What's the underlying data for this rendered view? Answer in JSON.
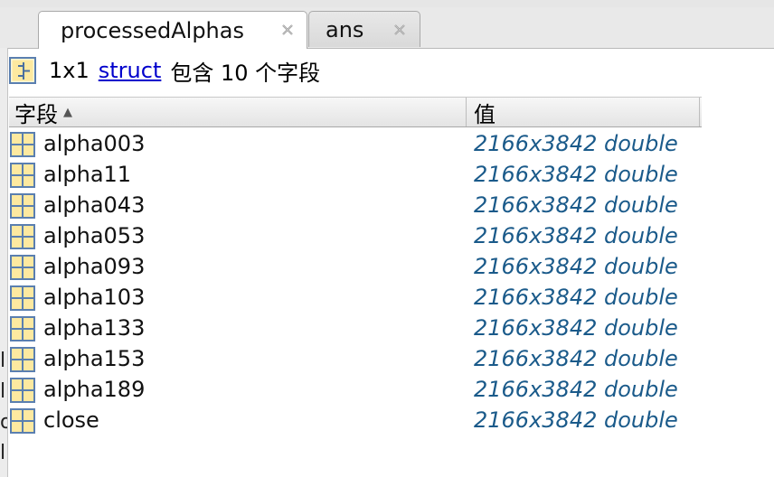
{
  "tabs": [
    {
      "label": "processedAlphas",
      "active": true
    },
    {
      "label": "ans",
      "active": false
    }
  ],
  "summary": {
    "size": "1x1",
    "type_link": "struct",
    "description": "包含 10 个字段"
  },
  "columns": {
    "field": "字段",
    "value": "值"
  },
  "rows": [
    {
      "name": "alpha003",
      "value": "2166x3842 double"
    },
    {
      "name": "alpha11",
      "value": "2166x3842 double"
    },
    {
      "name": "alpha043",
      "value": "2166x3842 double"
    },
    {
      "name": "alpha053",
      "value": "2166x3842 double"
    },
    {
      "name": "alpha093",
      "value": "2166x3842 double"
    },
    {
      "name": "alpha103",
      "value": "2166x3842 double"
    },
    {
      "name": "alpha133",
      "value": "2166x3842 double"
    },
    {
      "name": "alpha153",
      "value": "2166x3842 double"
    },
    {
      "name": "alpha189",
      "value": "2166x3842 double"
    },
    {
      "name": "close",
      "value": "2166x3842 double"
    }
  ],
  "icons": {
    "struct": "struct-icon",
    "field": "matrix-icon",
    "close": "close-icon",
    "sort": "sort-ascending-icon"
  },
  "colors": {
    "link": "#0000cc",
    "value_text": "#1a5a8a",
    "icon_fill": "#fde9a0",
    "icon_border": "#5a7fb0"
  }
}
